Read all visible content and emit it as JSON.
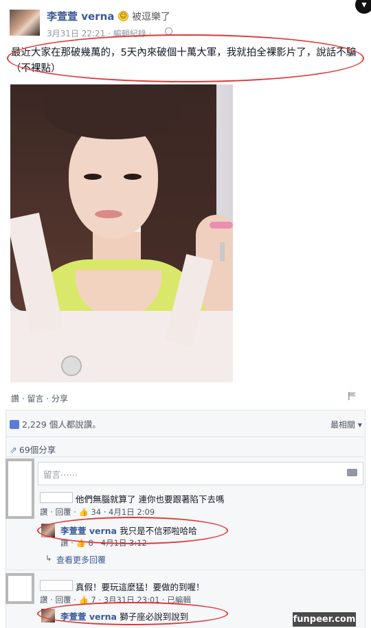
{
  "post": {
    "author": "李萱萱 verna",
    "feeling": "被逗樂了",
    "date": "3月31日 22:21",
    "edit_history": "· 編輯紀錄 ·",
    "text": "最近大家在那破幾萬的，5天內來破個十萬大軍，我就拍全裸影片了，說話不騙（不裸點）"
  },
  "actions": {
    "like": "讚",
    "comment": "留言",
    "share": "分享"
  },
  "ufi": {
    "likes_text": "2,229 個人都說讚。",
    "sort_label": "最相關",
    "shares_text": "69個分享",
    "comment_placeholder": "留言⋯⋯"
  },
  "comments": [
    {
      "text": "他們無腦就算了 連你也要跟著陷下去嗎",
      "reply_label": "讚 · 回覆 ·",
      "likes": "34",
      "time": "· 4月1日 2:09",
      "reply": {
        "name": "李萱萱 verna",
        "text": "我只是不信邪啦哈哈",
        "reply_label": "讚 ·",
        "likes": "8",
        "time": "· 4月1日 3:12"
      },
      "more_replies": "查看更多回覆"
    },
    {
      "text": "真假！要玩這麼猛！要做的到喔！",
      "reply_label": "讚 · 回覆 ·",
      "likes": "7",
      "time": "· 3月31日 23:01 · 已編輯",
      "reply": {
        "name": "李萱萱 verna",
        "text": "獅子座必說到說到"
      }
    }
  ],
  "watermark": "funpeer.com",
  "colors": {
    "link_blue": "#3b5998",
    "highlight_red": "#e23636",
    "like_blue": "#5b7bd5"
  }
}
